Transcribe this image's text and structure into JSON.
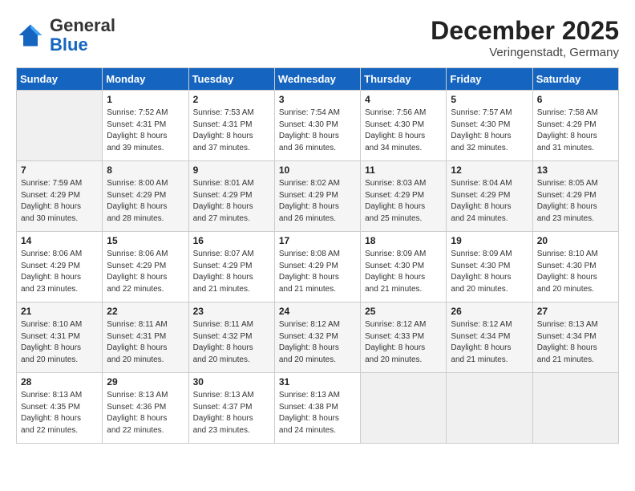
{
  "header": {
    "logo_general": "General",
    "logo_blue": "Blue",
    "month": "December 2025",
    "location": "Veringenstadt, Germany"
  },
  "weekdays": [
    "Sunday",
    "Monday",
    "Tuesday",
    "Wednesday",
    "Thursday",
    "Friday",
    "Saturday"
  ],
  "weeks": [
    [
      {
        "num": "",
        "info": ""
      },
      {
        "num": "1",
        "info": "Sunrise: 7:52 AM\nSunset: 4:31 PM\nDaylight: 8 hours\nand 39 minutes."
      },
      {
        "num": "2",
        "info": "Sunrise: 7:53 AM\nSunset: 4:31 PM\nDaylight: 8 hours\nand 37 minutes."
      },
      {
        "num": "3",
        "info": "Sunrise: 7:54 AM\nSunset: 4:30 PM\nDaylight: 8 hours\nand 36 minutes."
      },
      {
        "num": "4",
        "info": "Sunrise: 7:56 AM\nSunset: 4:30 PM\nDaylight: 8 hours\nand 34 minutes."
      },
      {
        "num": "5",
        "info": "Sunrise: 7:57 AM\nSunset: 4:30 PM\nDaylight: 8 hours\nand 32 minutes."
      },
      {
        "num": "6",
        "info": "Sunrise: 7:58 AM\nSunset: 4:29 PM\nDaylight: 8 hours\nand 31 minutes."
      }
    ],
    [
      {
        "num": "7",
        "info": "Sunrise: 7:59 AM\nSunset: 4:29 PM\nDaylight: 8 hours\nand 30 minutes."
      },
      {
        "num": "8",
        "info": "Sunrise: 8:00 AM\nSunset: 4:29 PM\nDaylight: 8 hours\nand 28 minutes."
      },
      {
        "num": "9",
        "info": "Sunrise: 8:01 AM\nSunset: 4:29 PM\nDaylight: 8 hours\nand 27 minutes."
      },
      {
        "num": "10",
        "info": "Sunrise: 8:02 AM\nSunset: 4:29 PM\nDaylight: 8 hours\nand 26 minutes."
      },
      {
        "num": "11",
        "info": "Sunrise: 8:03 AM\nSunset: 4:29 PM\nDaylight: 8 hours\nand 25 minutes."
      },
      {
        "num": "12",
        "info": "Sunrise: 8:04 AM\nSunset: 4:29 PM\nDaylight: 8 hours\nand 24 minutes."
      },
      {
        "num": "13",
        "info": "Sunrise: 8:05 AM\nSunset: 4:29 PM\nDaylight: 8 hours\nand 23 minutes."
      }
    ],
    [
      {
        "num": "14",
        "info": "Sunrise: 8:06 AM\nSunset: 4:29 PM\nDaylight: 8 hours\nand 23 minutes."
      },
      {
        "num": "15",
        "info": "Sunrise: 8:06 AM\nSunset: 4:29 PM\nDaylight: 8 hours\nand 22 minutes."
      },
      {
        "num": "16",
        "info": "Sunrise: 8:07 AM\nSunset: 4:29 PM\nDaylight: 8 hours\nand 21 minutes."
      },
      {
        "num": "17",
        "info": "Sunrise: 8:08 AM\nSunset: 4:29 PM\nDaylight: 8 hours\nand 21 minutes."
      },
      {
        "num": "18",
        "info": "Sunrise: 8:09 AM\nSunset: 4:30 PM\nDaylight: 8 hours\nand 21 minutes."
      },
      {
        "num": "19",
        "info": "Sunrise: 8:09 AM\nSunset: 4:30 PM\nDaylight: 8 hours\nand 20 minutes."
      },
      {
        "num": "20",
        "info": "Sunrise: 8:10 AM\nSunset: 4:30 PM\nDaylight: 8 hours\nand 20 minutes."
      }
    ],
    [
      {
        "num": "21",
        "info": "Sunrise: 8:10 AM\nSunset: 4:31 PM\nDaylight: 8 hours\nand 20 minutes."
      },
      {
        "num": "22",
        "info": "Sunrise: 8:11 AM\nSunset: 4:31 PM\nDaylight: 8 hours\nand 20 minutes."
      },
      {
        "num": "23",
        "info": "Sunrise: 8:11 AM\nSunset: 4:32 PM\nDaylight: 8 hours\nand 20 minutes."
      },
      {
        "num": "24",
        "info": "Sunrise: 8:12 AM\nSunset: 4:32 PM\nDaylight: 8 hours\nand 20 minutes."
      },
      {
        "num": "25",
        "info": "Sunrise: 8:12 AM\nSunset: 4:33 PM\nDaylight: 8 hours\nand 20 minutes."
      },
      {
        "num": "26",
        "info": "Sunrise: 8:12 AM\nSunset: 4:34 PM\nDaylight: 8 hours\nand 21 minutes."
      },
      {
        "num": "27",
        "info": "Sunrise: 8:13 AM\nSunset: 4:34 PM\nDaylight: 8 hours\nand 21 minutes."
      }
    ],
    [
      {
        "num": "28",
        "info": "Sunrise: 8:13 AM\nSunset: 4:35 PM\nDaylight: 8 hours\nand 22 minutes."
      },
      {
        "num": "29",
        "info": "Sunrise: 8:13 AM\nSunset: 4:36 PM\nDaylight: 8 hours\nand 22 minutes."
      },
      {
        "num": "30",
        "info": "Sunrise: 8:13 AM\nSunset: 4:37 PM\nDaylight: 8 hours\nand 23 minutes."
      },
      {
        "num": "31",
        "info": "Sunrise: 8:13 AM\nSunset: 4:38 PM\nDaylight: 8 hours\nand 24 minutes."
      },
      {
        "num": "",
        "info": ""
      },
      {
        "num": "",
        "info": ""
      },
      {
        "num": "",
        "info": ""
      }
    ]
  ]
}
